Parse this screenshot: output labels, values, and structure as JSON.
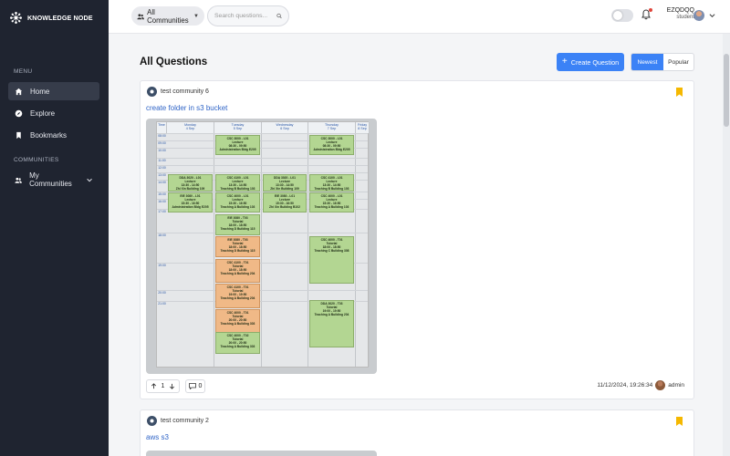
{
  "brand": {
    "name": "KNOWLEDGE NODE"
  },
  "sidebar": {
    "menu_label": "MENU",
    "items": [
      {
        "label": "Home",
        "icon": "home-icon",
        "active": true
      },
      {
        "label": "Explore",
        "icon": "compass-icon",
        "active": false
      },
      {
        "label": "Bookmarks",
        "icon": "bookmark-icon",
        "active": false
      }
    ],
    "communities_label": "COMMUNITIES",
    "communities_item": {
      "label": "My Communities",
      "icon": "users-icon"
    }
  },
  "topbar": {
    "community_selector": "All Communities",
    "search_placeholder": "Search questions...",
    "user_name": "EZQDQQ",
    "user_role": "student"
  },
  "main": {
    "title": "All Questions",
    "create_button": "Create Question",
    "sort_options": [
      {
        "label": "Newest",
        "active": true
      },
      {
        "label": "Popular",
        "active": false
      }
    ]
  },
  "questions": [
    {
      "community": "test community 6",
      "title": "create folder in s3 bucket",
      "votes": "1",
      "comments": "0",
      "timestamp": "11/12/2024, 19:26:34",
      "author": "admin",
      "timetable": {
        "days": [
          {
            "name": "Monday",
            "date": "4 Sep"
          },
          {
            "name": "Tuesday",
            "date": "5 Sep"
          },
          {
            "name": "Wednesday",
            "date": "6 Sep"
          },
          {
            "name": "Thursday",
            "date": "7 Sep"
          },
          {
            "name": "Friday",
            "date": "8 Sep"
          }
        ],
        "time_header": "Time",
        "times": [
          "08:00",
          "09:00",
          "10:00",
          "11:00",
          "12:00",
          "13:00",
          "14:00",
          "15:00",
          "16:00",
          "17:00",
          "18:00",
          "19:00",
          "20:00",
          "21:00"
        ],
        "events": [
          {
            "text": "CSC 3000 - L01\nLecture\n08:30 - 09:50\nAdministration Bldg E205"
          },
          {
            "text": "CSC 3000 - L01\nLecture\n08:30 - 09:50\nAdministration Bldg E205"
          },
          {
            "text": "DDA 3020 - L01\nLecture\n13:30 - 14:50\nZhi Xin Building 109"
          },
          {
            "text": "CSC 4100 - L01\nLecture\n13:30 - 14:50\nTeaching B Building 103"
          },
          {
            "text": "DDA 3020 - L01\nLecture\n13:30 - 14:50\nZhi Xin Building 109"
          },
          {
            "text": "CSC 4100 - L01\nLecture\n13:30 - 14:50\nTeaching B Building 103"
          },
          {
            "text": "EIE 3080 - L01\nLecture\n15:30 - 16:50\nAdministration Bldg E205"
          },
          {
            "text": "CSC 4000 - L01\nLecture\n15:30 - 16:50\nTeaching A Building 103"
          },
          {
            "text": "EIE 3080 - L01\nLecture\n15:30 - 16:50\nZhi Xin Building B102"
          },
          {
            "text": "CSC 4000 - L01\nLecture\n15:30 - 16:50\nTeaching A Building 103"
          },
          {
            "text": "EIE 3080 - T03\nTutorial\n18:00 - 18:50\nTeaching D Building 115"
          },
          {
            "text": "EIE 3080 - T03\nTutorial\n18:00 - 18:50\nTeaching D Building 115"
          },
          {
            "text": "CSC 4100 - T01\nTutorial\n18:00 - 18:50\nTeaching A Building 204"
          },
          {
            "text": "CSC 4000 - T01\nTutorial\n18:00 - 18:50\nTeaching C Building 308"
          },
          {
            "text": "CSC 4100 - T01\nTutorial\n19:00 - 19:50\nTeaching A Building 204"
          },
          {
            "text": "CSC 4000 - T01\nTutorial\n20:00 - 20:50\nTeaching A Building 303"
          },
          {
            "text": "DDA 3020 - T03\nTutorial\n19:00 - 19:50\nTeaching A Building 204"
          },
          {
            "text": "CSC 4000 - T02\nTutorial\n20:00 - 20:50\nTeaching A Building 303"
          }
        ]
      }
    },
    {
      "community": "test community 2",
      "title": "aws s3"
    }
  ],
  "colors": {
    "sidebar_bg": "#1f2430",
    "accent": "#3b82f6",
    "link": "#2f64c7",
    "bookmark": "#f5b800",
    "event_green": "#b3d692",
    "event_orange": "#f0b987"
  }
}
